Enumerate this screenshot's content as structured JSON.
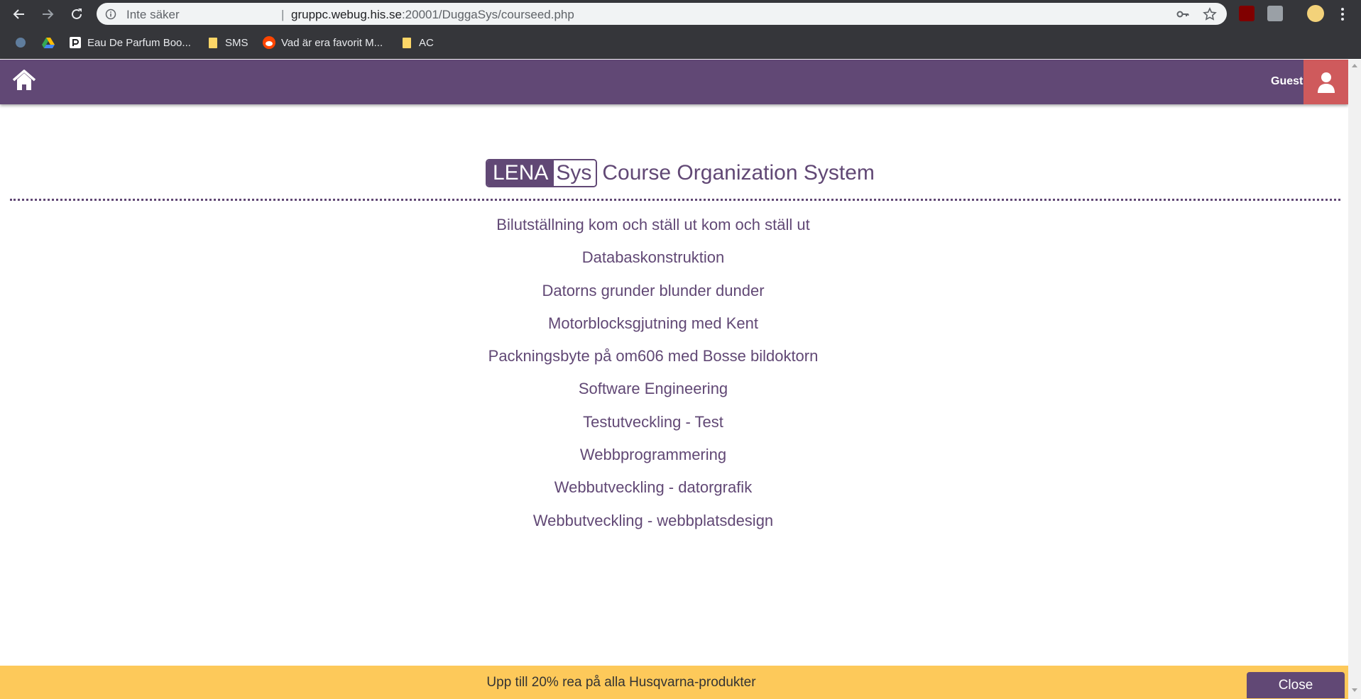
{
  "browser": {
    "security_label": "Inte säker",
    "separator": "|",
    "url_host": "gruppc.webug.his.se",
    "url_path": ":20001/DuggaSys/courseed.php",
    "bookmarks": [
      {
        "label": "",
        "icon": "google-drive-alt-icon"
      },
      {
        "label": "",
        "icon": "google-drive-icon"
      },
      {
        "label": "Eau De Parfum Boo...",
        "icon": "page-icon"
      },
      {
        "label": "SMS",
        "icon": "folder-icon"
      },
      {
        "label": "Vad är era favorit M...",
        "icon": "reddit-icon"
      },
      {
        "label": "AC",
        "icon": "folder-icon"
      }
    ]
  },
  "header": {
    "user_label": "Guest"
  },
  "main": {
    "logo_part1": "LENA",
    "logo_part2": "Sys",
    "subtitle": "Course Organization System",
    "courses": [
      "Bilutställning kom och ställ ut kom och ställ ut",
      "Databaskonstruktion",
      "Datorns grunder blunder dunder",
      "Motorblocksgjutning med Kent",
      "Packningsbyte på om606 med Bosse bildoktorn",
      "Software Engineering",
      "Testutveckling - Test",
      "Webbprogrammering",
      "Webbutveckling - datorgrafik",
      "Webbutveckling - webbplatsdesign"
    ]
  },
  "banner": {
    "text": "Upp till 20% rea på alla Husqvarna-produkter",
    "close_label": "Close"
  },
  "colors": {
    "brand": "#614875",
    "user_button": "#cf5a5c",
    "banner": "#fdc95a"
  }
}
